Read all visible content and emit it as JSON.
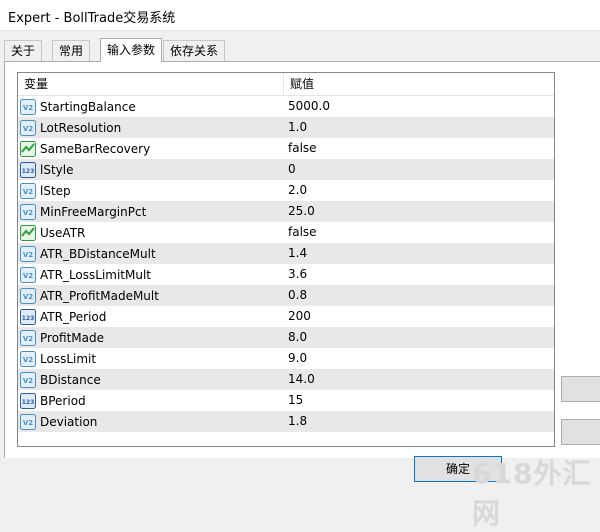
{
  "window": {
    "title": "Expert - BollTrade交易系统"
  },
  "tabs": [
    {
      "label": "关于"
    },
    {
      "label": "常用"
    },
    {
      "label": "输入参数"
    },
    {
      "label": "依存关系"
    }
  ],
  "active_tab": "输入参数",
  "table": {
    "headers": {
      "variable": "变量",
      "value": "赋值"
    },
    "rows": [
      {
        "name": "StartingBalance",
        "value": "5000.0",
        "icon": "double-value-icon"
      },
      {
        "name": "LotResolution",
        "value": "1.0",
        "icon": "double-value-icon"
      },
      {
        "name": "SameBarRecovery",
        "value": "false",
        "icon": "boolean-icon"
      },
      {
        "name": "lStyle",
        "value": "0",
        "icon": "integer-icon"
      },
      {
        "name": "lStep",
        "value": "2.0",
        "icon": "double-value-icon"
      },
      {
        "name": "MinFreeMarginPct",
        "value": "25.0",
        "icon": "double-value-icon"
      },
      {
        "name": "UseATR",
        "value": "false",
        "icon": "boolean-icon"
      },
      {
        "name": "ATR_BDistanceMult",
        "value": "1.4",
        "icon": "double-value-icon"
      },
      {
        "name": "ATR_LossLimitMult",
        "value": "3.6",
        "icon": "double-value-icon"
      },
      {
        "name": "ATR_ProfitMadeMult",
        "value": "0.8",
        "icon": "double-value-icon"
      },
      {
        "name": "ATR_Period",
        "value": "200",
        "icon": "integer-icon"
      },
      {
        "name": "ProfitMade",
        "value": "8.0",
        "icon": "double-value-icon"
      },
      {
        "name": "LossLimit",
        "value": "9.0",
        "icon": "double-value-icon"
      },
      {
        "name": "BDistance",
        "value": "14.0",
        "icon": "double-value-icon"
      },
      {
        "name": "BPeriod",
        "value": "15",
        "icon": "integer-icon"
      },
      {
        "name": "Deviation",
        "value": "1.8",
        "icon": "double-value-icon"
      }
    ]
  },
  "buttons": {
    "ok_label": "确定"
  },
  "watermark": "618外汇网",
  "colors": {
    "double_icon": "#4a90c8",
    "bool_icon": "#2e9e3a",
    "int_icon": "#2a5fa8"
  }
}
